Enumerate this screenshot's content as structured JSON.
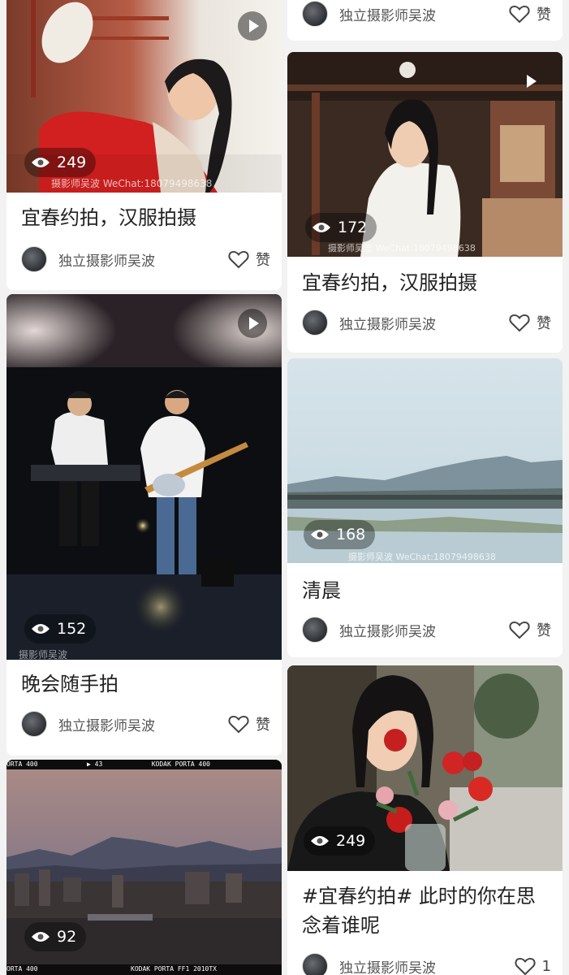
{
  "feed": {
    "cards": [
      {
        "id": "c0",
        "title": "",
        "author": "独立摄影师吴波",
        "like_label": "赞",
        "views": ""
      },
      {
        "id": "c1",
        "title": "宜春约拍，汉服拍摄",
        "author": "独立摄影师吴波",
        "like_label": "赞",
        "views": "249",
        "photo_theme": "red-hanfu-portrait"
      },
      {
        "id": "c2",
        "title": "宜春约拍，汉服拍摄",
        "author": "独立摄影师吴波",
        "like_label": "赞",
        "views": "172",
        "photo_theme": "white-hanfu-pavilion"
      },
      {
        "id": "c3",
        "title": "晚会随手拍",
        "author": "独立摄影师吴波",
        "like_label": "赞",
        "views": "152",
        "photo_theme": "stage-band"
      },
      {
        "id": "c4",
        "title": "清晨",
        "author": "独立摄影师吴波",
        "like_label": "赞",
        "views": "168",
        "photo_theme": "river-morning"
      },
      {
        "id": "c5",
        "title": "#宜春约拍# 此时的你在思念着谁呢",
        "title_line1": "#宜春约拍# 此时的你在思",
        "title_line2": "念着谁呢",
        "author": "独立摄影师吴波",
        "like_label": "1",
        "views": "249",
        "photo_theme": "rose-portrait"
      },
      {
        "id": "c6",
        "title": "",
        "author": "",
        "like_label": "",
        "views": "92",
        "film_top": [
          "ORTA 400",
          "▶ 43",
          "KODAK PORTA 400"
        ],
        "film_bottom": [
          "ORTA 400",
          "KODAK PORTA  FF1  2010TX"
        ],
        "photo_theme": "city-dusk-film"
      }
    ]
  },
  "icons": {
    "view": "eye-icon",
    "play": "play-icon",
    "like": "heart-icon"
  },
  "colors": {
    "background": "#f2f2f2",
    "card": "#ffffff",
    "text": "#222222",
    "muted": "#555555"
  }
}
